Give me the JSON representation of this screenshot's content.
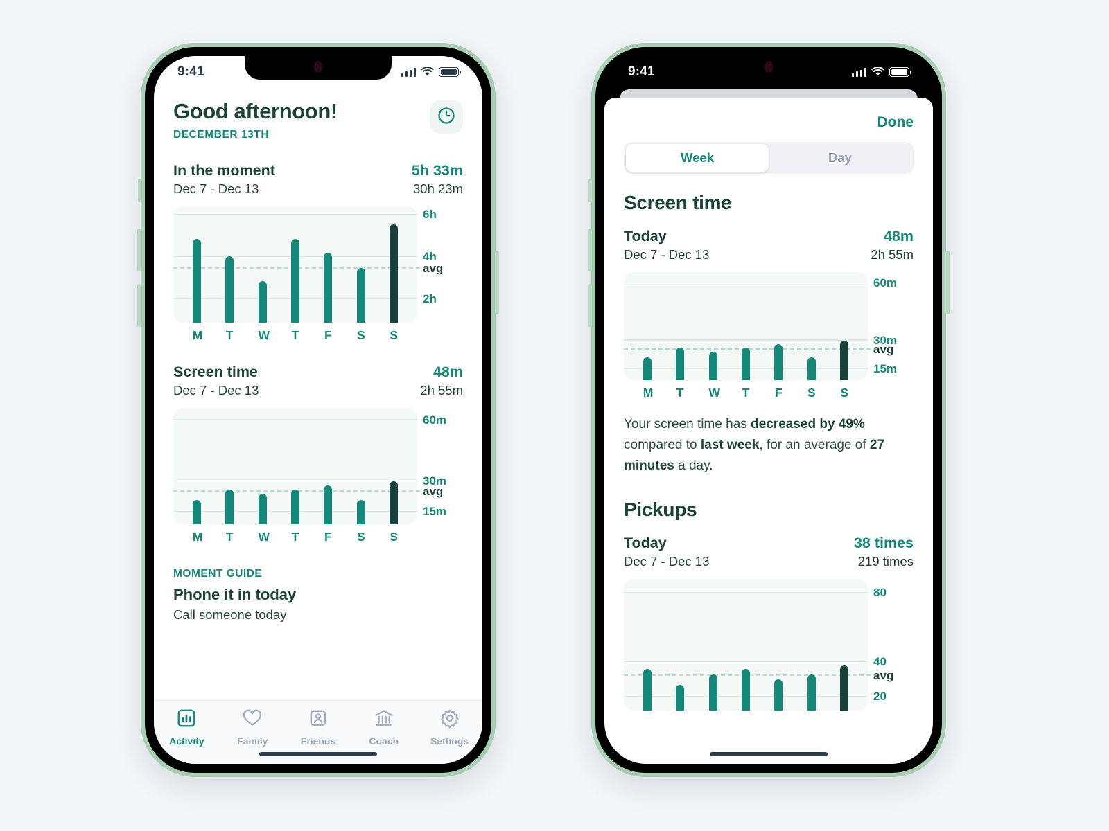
{
  "colors": {
    "accent": "#17877a",
    "bar": "#15887a",
    "bar_today": "#17413a",
    "heading": "#1d4339",
    "chart_bg": "#f4f8f6",
    "gridline": "#d8ece5",
    "avg_dash": "#b4ded2",
    "page_bg": "#f2f5f9",
    "phone_frame": "#a9cdb5"
  },
  "phone1": {
    "status_bar": {
      "time": "9:41",
      "signal_icon": "cellular-signal-icon",
      "wifi_icon": "wifi-icon",
      "battery_icon": "battery-icon"
    },
    "header": {
      "greeting": "Good afternoon!",
      "date": "DECEMBER 13TH",
      "clock_button_icon": "clock-icon"
    },
    "moment_section": {
      "title": "In the moment",
      "value": "5h 33m",
      "range": "Dec 7 - Dec 13",
      "total": "30h 23m"
    },
    "screen_time_section": {
      "title": "Screen time",
      "value": "48m",
      "range": "Dec 7 - Dec 13",
      "total": "2h 55m"
    },
    "moment_guide": {
      "label": "MOMENT GUIDE",
      "title": "Phone it in today",
      "subtitle": "Call someone today"
    },
    "tabs": [
      {
        "label": "Activity",
        "icon": "bar-chart-icon",
        "active": true
      },
      {
        "label": "Family",
        "icon": "heart-icon",
        "active": false
      },
      {
        "label": "Friends",
        "icon": "person-card-icon",
        "active": false
      },
      {
        "label": "Coach",
        "icon": "bank-icon",
        "active": false
      },
      {
        "label": "Settings",
        "icon": "gear-icon",
        "active": false
      }
    ]
  },
  "phone2": {
    "status_bar": {
      "time": "9:41",
      "signal_icon": "cellular-signal-icon",
      "wifi_icon": "wifi-icon",
      "battery_icon": "battery-icon"
    },
    "done_label": "Done",
    "segmented": {
      "options": [
        "Week",
        "Day"
      ],
      "selected": "Week"
    },
    "screen_time": {
      "heading": "Screen time",
      "today_label": "Today",
      "today_value": "48m",
      "range": "Dec 7 - Dec 13",
      "total": "2h 55m",
      "blurb": {
        "p1": "Your screen time has ",
        "b1": "decreased by 49%",
        "p2": " compared to ",
        "b2": "last week",
        "p3": ", for an average of ",
        "b3": "27 minutes",
        "p4": " a day."
      }
    },
    "pickups": {
      "heading": "Pickups",
      "today_label": "Today",
      "today_value": "38 times",
      "range": "Dec 7 - Dec 13",
      "total": "219 times"
    }
  },
  "chart_data": [
    {
      "id": "moment_week",
      "type": "bar",
      "title": "In the moment",
      "xlabel": "",
      "ylabel": "hours",
      "categories": [
        "M",
        "T",
        "W",
        "T",
        "F",
        "S",
        "S"
      ],
      "values": [
        4.85,
        4.05,
        2.85,
        4.85,
        4.2,
        3.5,
        5.55
      ],
      "ytick_labels": [
        "6h",
        "4h",
        "avg",
        "2h"
      ],
      "ytick_values": [
        6,
        4,
        3.45,
        2
      ],
      "ylim": [
        0.9,
        6.4
      ],
      "average": 3.45,
      "average_label": "avg",
      "highlight_index": 6,
      "grid": true,
      "legend": "none"
    },
    {
      "id": "screentime_week_home",
      "type": "bar",
      "title": "Screen time",
      "xlabel": "",
      "ylabel": "minutes",
      "categories": [
        "M",
        "T",
        "W",
        "T",
        "F",
        "S",
        "S"
      ],
      "values": [
        21,
        26,
        24,
        26,
        28,
        21,
        30
      ],
      "ytick_labels": [
        "60m",
        "30m",
        "avg",
        "15m"
      ],
      "ytick_values": [
        60,
        30,
        25,
        15
      ],
      "ylim": [
        9,
        66
      ],
      "average": 25,
      "average_label": "avg",
      "highlight_index": 6,
      "grid": true,
      "legend": "none"
    },
    {
      "id": "screentime_week_sheet",
      "type": "bar",
      "title": "Screen time",
      "xlabel": "",
      "ylabel": "minutes",
      "categories": [
        "M",
        "T",
        "W",
        "T",
        "F",
        "S",
        "S"
      ],
      "values": [
        21,
        26,
        24,
        26,
        28,
        21,
        30
      ],
      "ytick_labels": [
        "60m",
        "30m",
        "avg",
        "15m"
      ],
      "ytick_values": [
        60,
        30,
        25,
        15
      ],
      "ylim": [
        9,
        66
      ],
      "average": 25,
      "average_label": "avg",
      "highlight_index": 6,
      "grid": true,
      "legend": "none"
    },
    {
      "id": "pickups_week",
      "type": "bar",
      "title": "Pickups",
      "xlabel": "",
      "ylabel": "times",
      "categories": [
        "M",
        "T",
        "W",
        "T",
        "F",
        "S",
        "S"
      ],
      "values": [
        36,
        27,
        33,
        36,
        30,
        33,
        38
      ],
      "ytick_labels": [
        "80",
        "40",
        "avg",
        "20"
      ],
      "ytick_values": [
        80,
        40,
        32,
        20
      ],
      "ylim": [
        12,
        88
      ],
      "average": 32,
      "average_label": "avg",
      "highlight_index": 6,
      "grid": true,
      "legend": "none"
    }
  ]
}
